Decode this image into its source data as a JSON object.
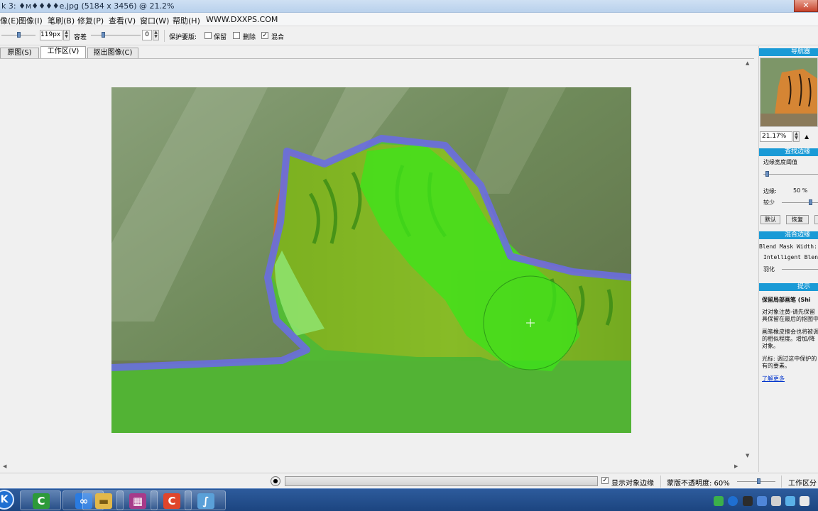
{
  "window": {
    "title": "k 3: ♦м♦♦♦♦e.jpg (5184 x 3456) @ 21.2%",
    "close_glyph": "✕"
  },
  "menu": [
    {
      "label": "像(E)"
    },
    {
      "label": "图像(I)"
    },
    {
      "label": "笔刷(B)"
    },
    {
      "label": "修复(P)"
    },
    {
      "label": "查看(V)"
    },
    {
      "label": "窗口(W)"
    },
    {
      "label": "帮助(H)"
    },
    {
      "label": "WWW.DXXPS.COM"
    }
  ],
  "options": {
    "brush_size": "119px",
    "tolerance_label": "容差",
    "tolerance_value": "0",
    "protect_label": "保护要版:",
    "keep_label": "保留",
    "delete_label": "删除",
    "blend_label": "混合",
    "blend_checked": "✓"
  },
  "tabs": [
    {
      "label": "原图(S)"
    },
    {
      "label": "工作区(V)"
    },
    {
      "label": "抠出图像(C)"
    }
  ],
  "panel": {
    "navigator_title": "导航器",
    "zoom_value": "21.17%",
    "edge_title": "查找边缘",
    "edge_threshold": "边缘宽度阈值",
    "edge_value_label": "边缘:",
    "edge_value": "50 %",
    "less_label": "较少",
    "default_btn": "默认",
    "restore_btn": "恢复",
    "blend_edge_title": "混合边缘",
    "blend_mask_width": "Blend Mask Width:",
    "intelligent_blend": "Intelligent Blend",
    "feather_label": "羽化",
    "hints_title": "提示",
    "hint_heading": "保留局部画笔 (Shi",
    "hint_line1": "对对象注黄-请先保留",
    "hint_line2": "具保留在最后的抠图中",
    "hint_line3": "画笔橡皮擦会也将被调",
    "hint_line4": "的相似程度。增加/降",
    "hint_line5": "对象。",
    "hint_line6": "光标: 调过这中保护的",
    "hint_line7": "有的要素。",
    "learn_more": "了解更多"
  },
  "status": {
    "show_edges_label": "显示对象边缘",
    "show_edges_checked": "✓",
    "opacity_label": "蒙版不透明度: 60%",
    "workspace_label": "工作区分"
  },
  "taskbar": {
    "items": [
      {
        "icon": "k-icon",
        "glyph": "K",
        "color": "#1f6fd1"
      },
      {
        "icon": "camtasia-icon",
        "glyph": "C",
        "color": "#2d9a3a"
      },
      {
        "icon": "baidu-cloud-icon",
        "glyph": "∞",
        "color": "#2a7be0"
      },
      {
        "icon": "folder-icon",
        "glyph": "▬",
        "color": "#e2b84a"
      },
      {
        "icon": "archive-icon",
        "glyph": "▦",
        "color": "#a73b8a"
      },
      {
        "icon": "camtasia-recorder-icon",
        "glyph": "C",
        "color": "#e0452b"
      },
      {
        "icon": "photo-app-icon",
        "glyph": "∫",
        "color": "#5aa0d8"
      }
    ]
  },
  "colors": {
    "mask_green": "#3ee31a",
    "edge_blue": "#6a6de0",
    "panel_header": "#1a9ad6"
  }
}
